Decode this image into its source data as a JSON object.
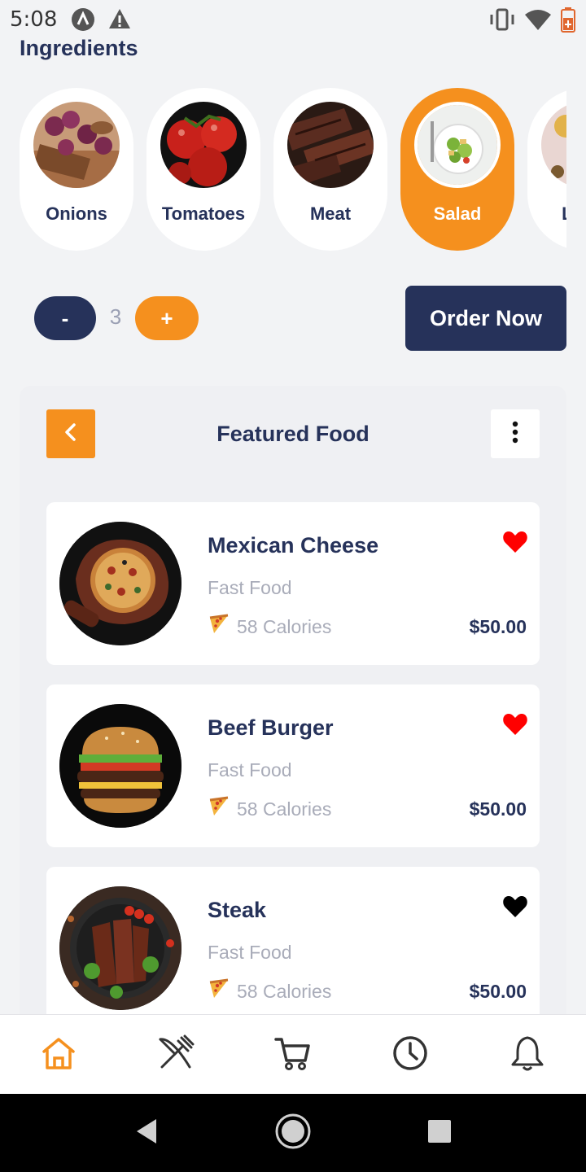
{
  "status_bar": {
    "time": "5:08"
  },
  "ingredients": {
    "title": "Ingredients",
    "items": [
      {
        "label": "Onions",
        "icon": "onion-photo",
        "selected": false
      },
      {
        "label": "Tomatoes",
        "icon": "tomato-photo",
        "selected": false
      },
      {
        "label": "Meat",
        "icon": "meat-photo",
        "selected": false
      },
      {
        "label": "Salad",
        "icon": "salad-photo",
        "selected": true
      },
      {
        "label": "Le",
        "icon": "lemon-photo",
        "selected": false
      }
    ]
  },
  "quantity": {
    "minus_label": "-",
    "value": "3",
    "plus_label": "+"
  },
  "order_button": {
    "label": "Order Now"
  },
  "featured": {
    "title": "Featured Food",
    "items": [
      {
        "name": "Mexican Cheese",
        "category": "Fast Food",
        "calories": "58 Calories",
        "price": "$50.00",
        "favorite": true,
        "image": "pizza-photo"
      },
      {
        "name": "Beef Burger",
        "category": "Fast Food",
        "calories": "58 Calories",
        "price": "$50.00",
        "favorite": true,
        "image": "burger-photo"
      },
      {
        "name": "Steak",
        "category": "Fast Food",
        "calories": "58 Calories",
        "price": "$50.00",
        "favorite": false,
        "image": "steak-photo"
      }
    ]
  },
  "bottom_nav": {
    "active": "home",
    "items": [
      "home-icon",
      "cutlery-icon",
      "cart-icon",
      "clock-icon",
      "bell-icon"
    ]
  },
  "colors": {
    "accent": "#f5901e",
    "primary": "#26325a",
    "muted": "#a9acb9",
    "favorite": "#ff0000",
    "background": "#f2f3f5"
  }
}
